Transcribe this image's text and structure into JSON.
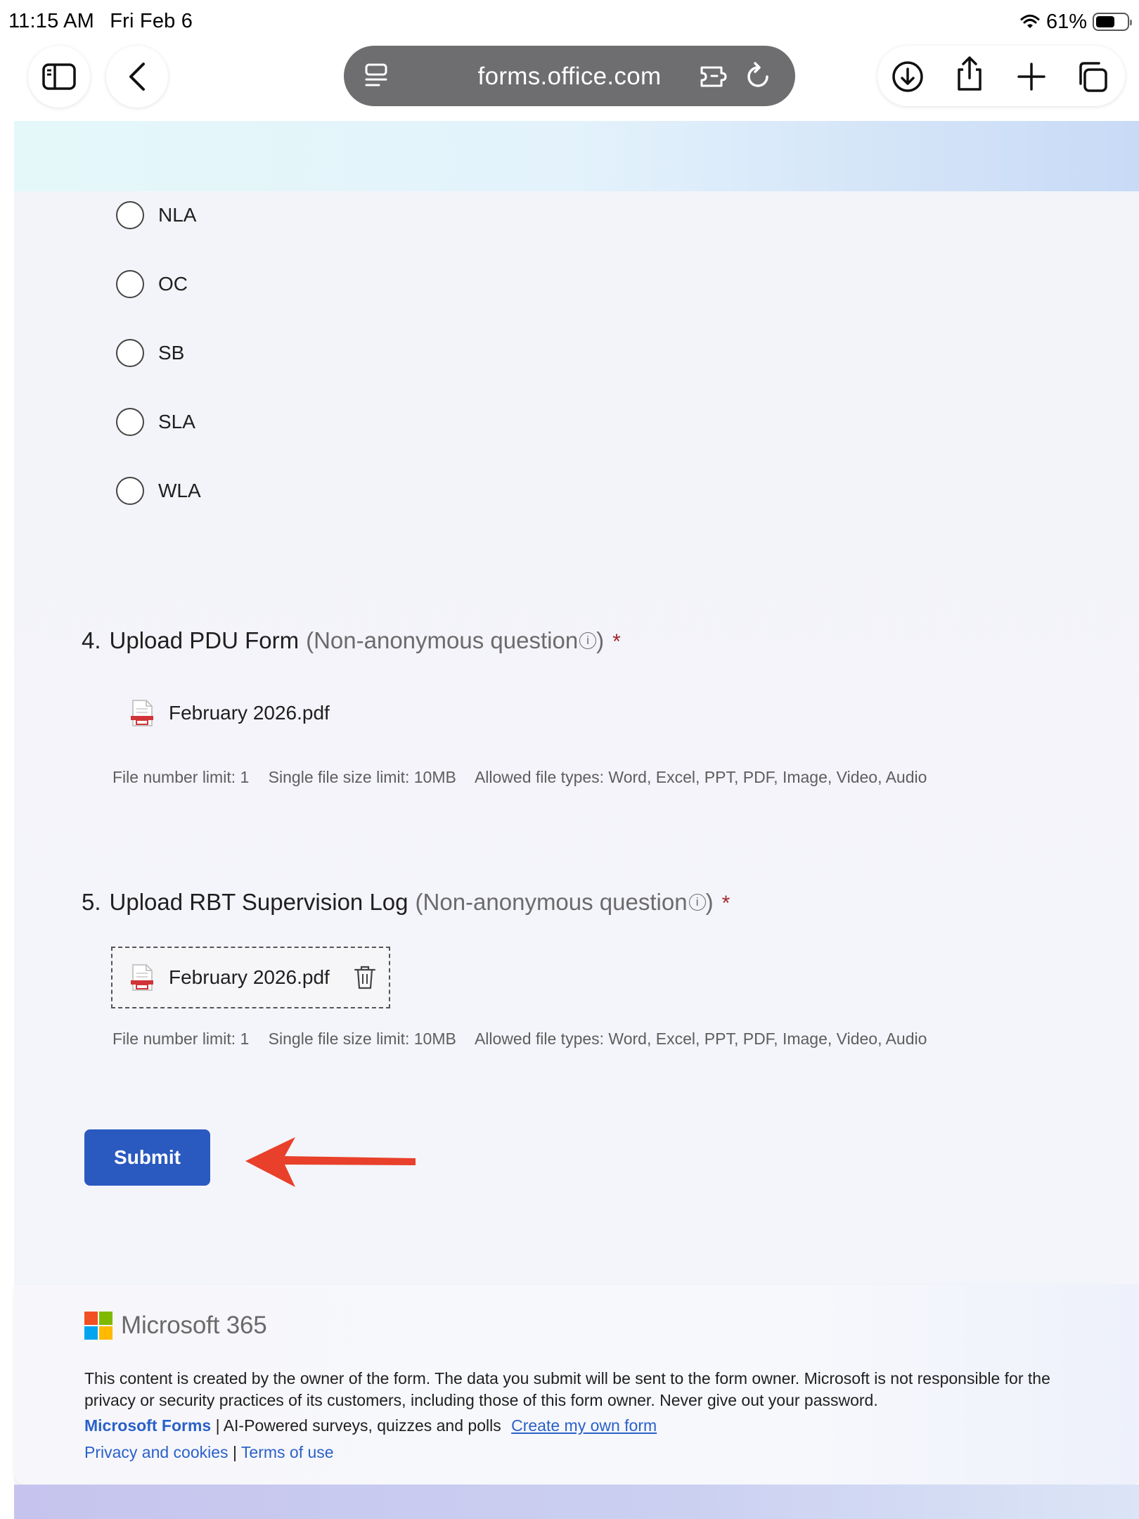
{
  "status_bar": {
    "time": "11:15 AM",
    "date": "Fri Feb 6",
    "battery": "61%",
    "battery_level": 0.61
  },
  "browser": {
    "url": "forms.office.com",
    "icons": {
      "sidebar": "sidebar-icon",
      "back": "chevron-left-icon",
      "reader": "reader-mode-icon",
      "extension": "extension-icon",
      "reload": "reload-icon",
      "download": "download-icon",
      "share": "share-icon",
      "new_tab": "plus-icon",
      "tabs": "tabs-icon"
    }
  },
  "choices": [
    "NLA",
    "OC",
    "SB",
    "SLA",
    "WLA"
  ],
  "questions": [
    {
      "number": "4.",
      "title": "Upload PDU Form",
      "subtitle_open": "(Non-anonymous question",
      "subtitle_close": ")",
      "required_mark": "*",
      "file_name": "February 2026.pdf",
      "hints": [
        "File number limit: 1",
        "Single file size limit: 10MB",
        "Allowed file types: Word, Excel, PPT, PDF, Image, Video, Audio"
      ]
    },
    {
      "number": "5.",
      "title": "Upload RBT Supervision Log",
      "subtitle_open": "(Non-anonymous question",
      "subtitle_close": ")",
      "required_mark": "*",
      "file_name": "February 2026.pdf",
      "hints": [
        "File number limit: 1",
        "Single file size limit: 10MB",
        "Allowed file types: Word, Excel, PPT, PDF, Image, Video, Audio"
      ]
    }
  ],
  "info_glyph": "i",
  "submit_label": "Submit",
  "footer": {
    "brand": "Microsoft 365",
    "note": "This content is created by the owner of the form. The data you submit will be sent to the form owner. Microsoft is not responsible for the privacy or security practices of its customers, including those of this form owner. Never give out your password.",
    "forms_link": "Microsoft Forms",
    "separator": "|",
    "tagline": "AI-Powered surveys, quizzes and polls",
    "create_link": "Create my own form",
    "privacy_link": "Privacy and cookies",
    "terms_link": "Terms of use"
  },
  "colors": {
    "primary_button": "#2a59c0",
    "link": "#2a61c9",
    "required": "#a4262c",
    "annotation_arrow": "#e8402a"
  }
}
